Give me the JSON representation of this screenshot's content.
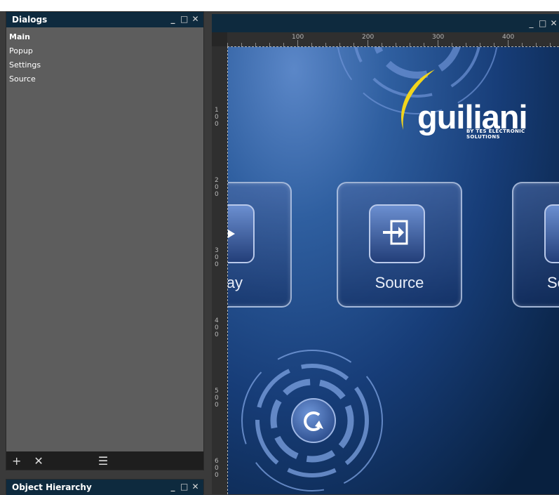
{
  "dialogs_panel": {
    "title": "Dialogs",
    "items": [
      {
        "label": "Main",
        "active": true
      },
      {
        "label": "Popup",
        "active": false
      },
      {
        "label": "Settings",
        "active": false
      },
      {
        "label": "Source",
        "active": false
      }
    ],
    "window_buttons": {
      "minimize": "_",
      "maximize": "□",
      "close": "✕"
    },
    "footer": {
      "add": "+",
      "delete": "✕",
      "list": "☰"
    }
  },
  "object_hierarchy_panel": {
    "title": "Object Hierarchy",
    "window_buttons": {
      "minimize": "_",
      "maximize": "□",
      "close": "✕"
    }
  },
  "canvas": {
    "window_buttons": {
      "minimize": "_",
      "maximize": "□",
      "close": "✕"
    },
    "ruler_top": [
      "100",
      "200",
      "300",
      "400"
    ],
    "ruler_left": [
      "100",
      "200",
      "300",
      "400",
      "500",
      "600"
    ],
    "brand": {
      "name": "guiliani",
      "tagline": "BY TES ELECTRONIC SOLUTIONS"
    },
    "tiles": [
      {
        "label": "ay"
      },
      {
        "label": "Source"
      },
      {
        "label": "Se"
      }
    ]
  }
}
